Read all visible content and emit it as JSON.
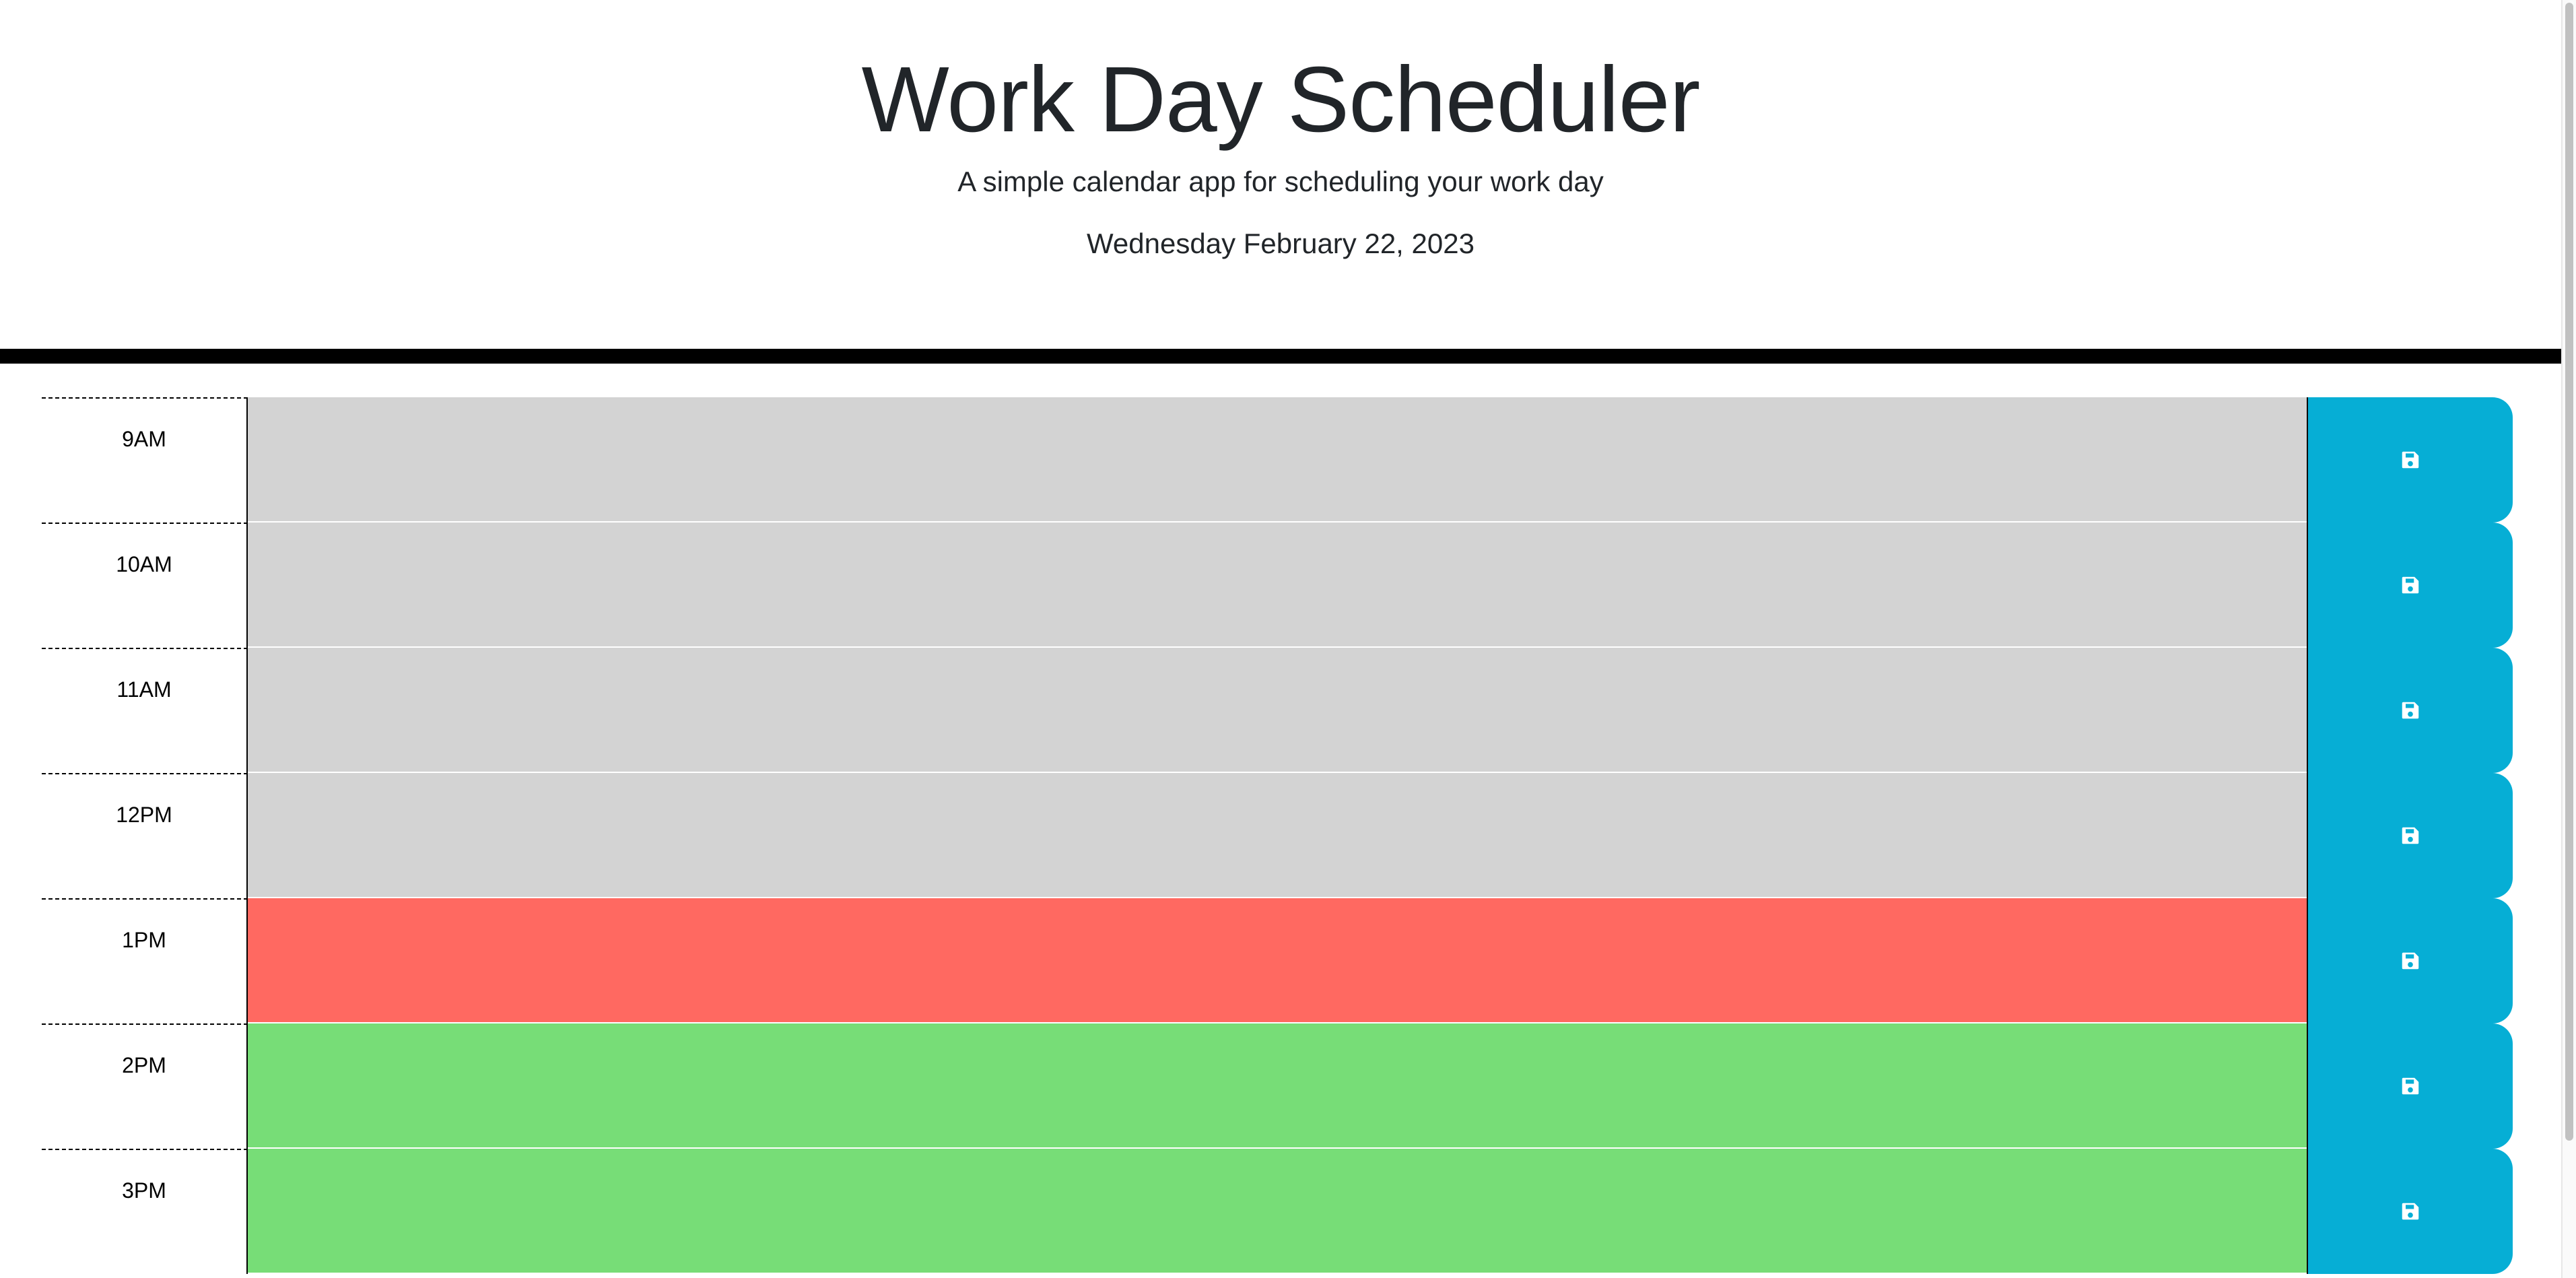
{
  "header": {
    "title": "Work Day Scheduler",
    "subtitle": "A simple calendar app for scheduling your work day",
    "current_day": "Wednesday February 22, 2023"
  },
  "colors": {
    "past": "#d3d3d3",
    "present": "#ff6961",
    "future": "#77dd77",
    "save_button": "#06aed5",
    "header_border": "#000000"
  },
  "time_blocks": [
    {
      "hour": "9AM",
      "status": "past",
      "text": "",
      "save_icon": "floppy-disk-icon"
    },
    {
      "hour": "10AM",
      "status": "past",
      "text": "",
      "save_icon": "floppy-disk-icon"
    },
    {
      "hour": "11AM",
      "status": "past",
      "text": "",
      "save_icon": "floppy-disk-icon"
    },
    {
      "hour": "12PM",
      "status": "past",
      "text": "",
      "save_icon": "floppy-disk-icon"
    },
    {
      "hour": "1PM",
      "status": "present",
      "text": "",
      "save_icon": "floppy-disk-icon"
    },
    {
      "hour": "2PM",
      "status": "future",
      "text": "",
      "save_icon": "floppy-disk-icon"
    },
    {
      "hour": "3PM",
      "status": "future",
      "text": "",
      "save_icon": "floppy-disk-icon"
    }
  ]
}
